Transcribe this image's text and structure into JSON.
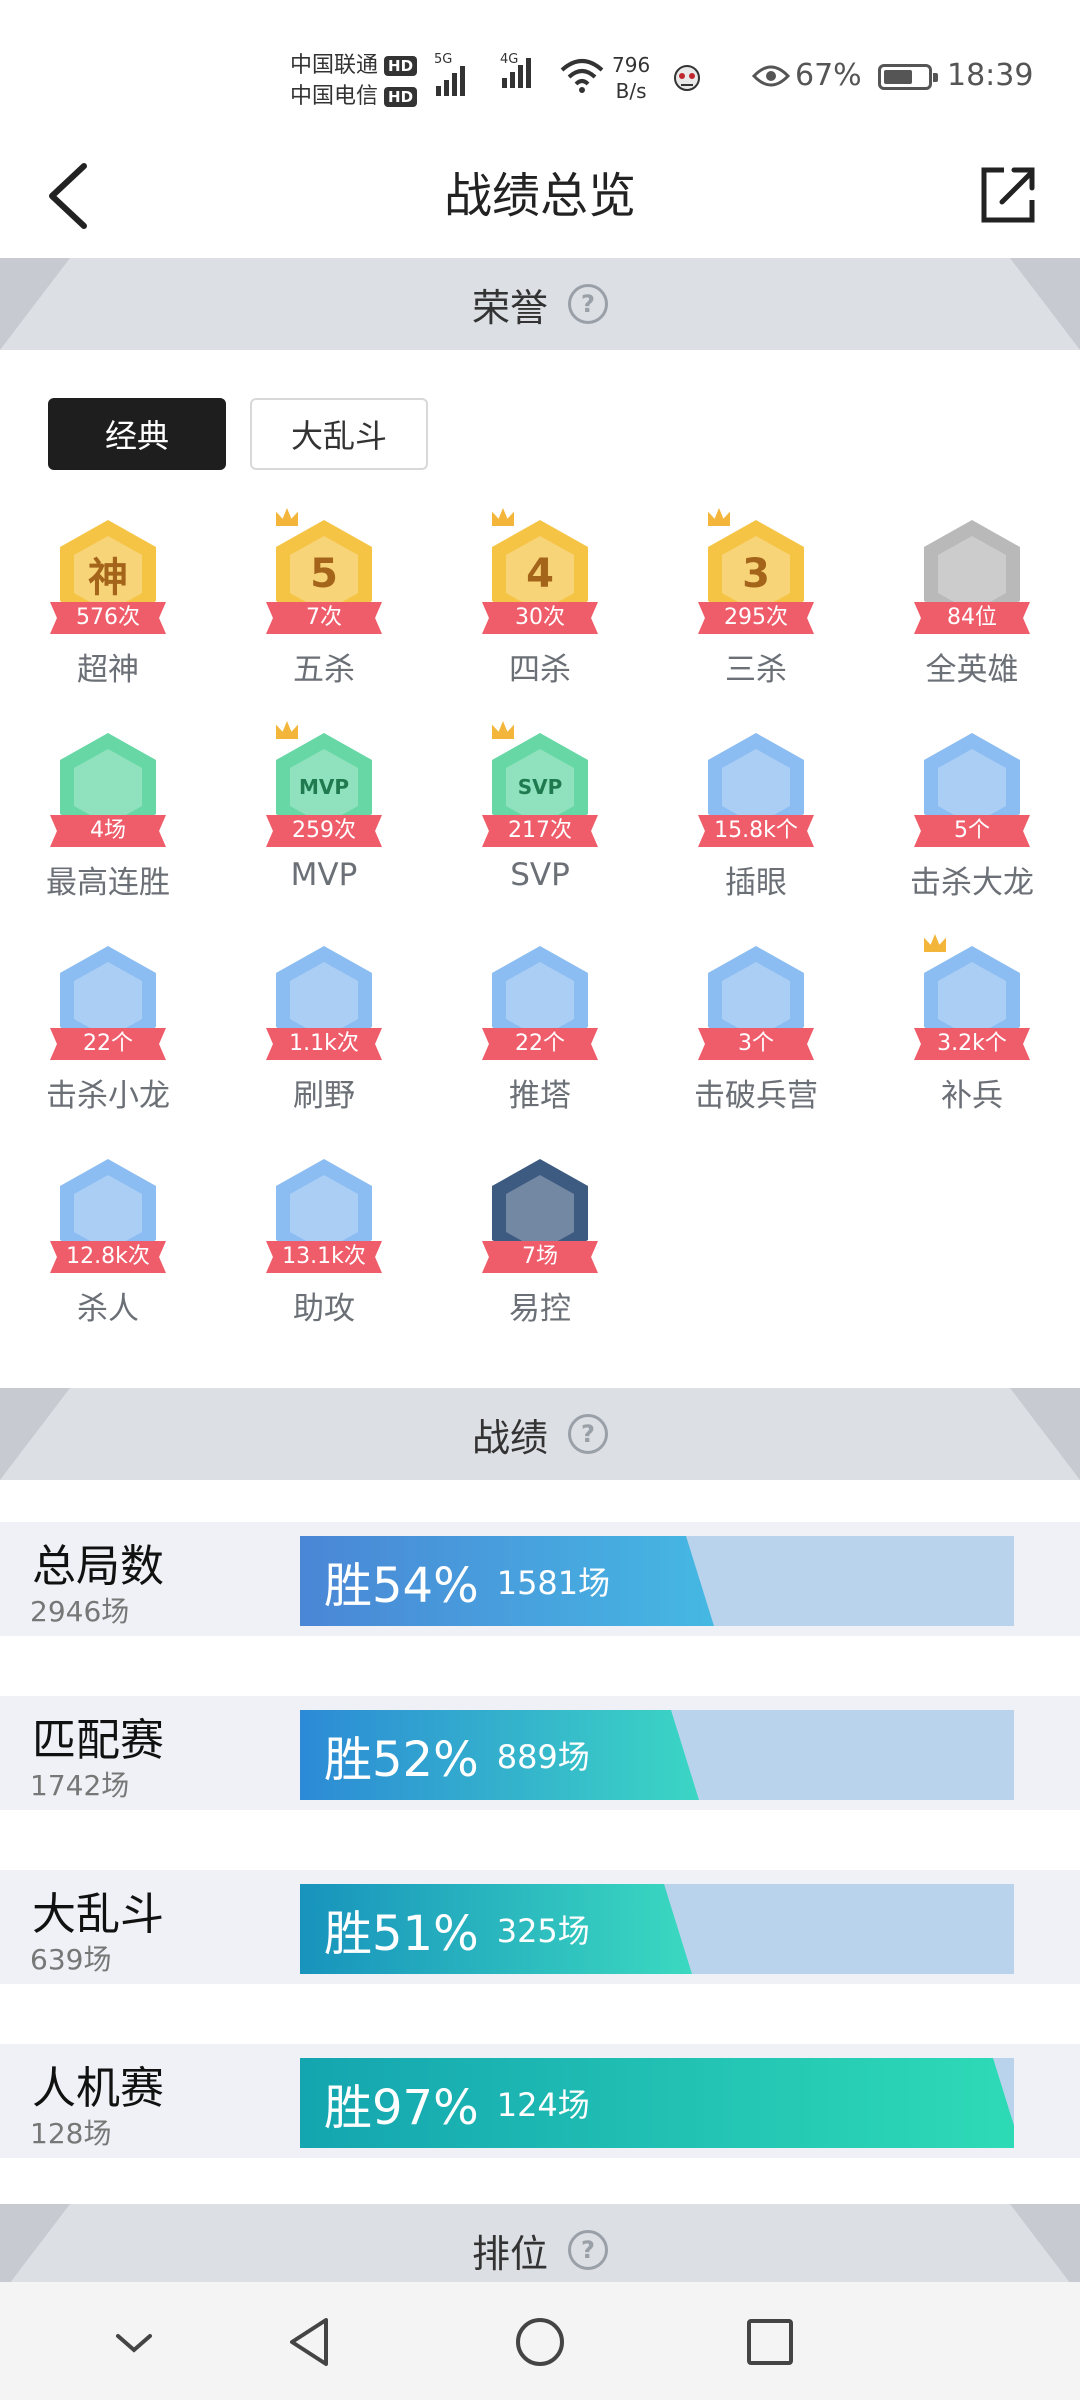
{
  "status_bar": {
    "carrier1": "中国联通",
    "carrier2": "中国电信",
    "hd": "HD",
    "net1": "5G",
    "net2": "4G",
    "speed_value": "796",
    "speed_unit": "B/s",
    "battery_pct": "67%",
    "battery_level": 0.67,
    "time": "18:39"
  },
  "header": {
    "title": "战绩总览",
    "back_icon": "back-chevron-icon",
    "share_icon": "share-external-icon"
  },
  "honor_section": {
    "title": "荣誉",
    "help": "?",
    "tabs": [
      {
        "label": "经典"
      },
      {
        "label": "大乱斗"
      }
    ],
    "items": [
      {
        "glyph": "神",
        "badge": "576次",
        "label": "超神",
        "color": "#f6c445"
      },
      {
        "glyph": "5",
        "badge": "7次",
        "label": "五杀",
        "color": "#f6c445"
      },
      {
        "glyph": "4",
        "badge": "30次",
        "label": "四杀",
        "color": "#f6c445"
      },
      {
        "glyph": "3",
        "badge": "295次",
        "label": "三杀",
        "color": "#f6c445"
      },
      {
        "glyph": "",
        "badge": "84位",
        "label": "全英雄",
        "color": "#b9b9b9"
      },
      {
        "glyph": "",
        "badge": "4场",
        "label": "最高连胜",
        "color": "#66d7a5"
      },
      {
        "glyph": "MVP",
        "badge": "259次",
        "label": "MVP",
        "color": "#66d7a5"
      },
      {
        "glyph": "SVP",
        "badge": "217次",
        "label": "SVP",
        "color": "#66d7a5"
      },
      {
        "glyph": "",
        "badge": "15.8k个",
        "label": "插眼",
        "color": "#8bbcf2"
      },
      {
        "glyph": "",
        "badge": "5个",
        "label": "击杀大龙",
        "color": "#8bbcf2"
      },
      {
        "glyph": "",
        "badge": "22个",
        "label": "击杀小龙",
        "color": "#8bbcf2"
      },
      {
        "glyph": "",
        "badge": "1.1k次",
        "label": "刷野",
        "color": "#8bbcf2"
      },
      {
        "glyph": "",
        "badge": "22个",
        "label": "推塔",
        "color": "#8bbcf2"
      },
      {
        "glyph": "",
        "badge": "3个",
        "label": "击破兵营",
        "color": "#8bbcf2"
      },
      {
        "glyph": "",
        "badge": "3.2k个",
        "label": "补兵",
        "color": "#8bbcf2"
      },
      {
        "glyph": "",
        "badge": "12.8k次",
        "label": "杀人",
        "color": "#8bbcf2"
      },
      {
        "glyph": "",
        "badge": "13.1k次",
        "label": "助攻",
        "color": "#8bbcf2"
      },
      {
        "glyph": "",
        "badge": "7场",
        "label": "易控",
        "color": "#3d5a80"
      }
    ]
  },
  "record_section": {
    "title": "战绩",
    "help": "?",
    "rows": [
      {
        "name": "总局数",
        "count": "2946场",
        "win_text": "胜54%",
        "win_games": "1581场",
        "win_rate": 0.54,
        "from": "#4a86d6",
        "to": "#45b8e3"
      },
      {
        "name": "匹配赛",
        "count": "1742场",
        "win_text": "胜52%",
        "win_games": "889场",
        "win_rate": 0.52,
        "from": "#2c8ad6",
        "to": "#3bd6c4"
      },
      {
        "name": "大乱斗",
        "count": "639场",
        "win_text": "胜51%",
        "win_games": "325场",
        "win_rate": 0.51,
        "from": "#1893bd",
        "to": "#3bd9c0"
      },
      {
        "name": "人机赛",
        "count": "128场",
        "win_text": "胜97%",
        "win_games": "124场",
        "win_rate": 0.97,
        "from": "#14a5b0",
        "to": "#2edbb6"
      }
    ]
  },
  "rank_section": {
    "title": "排位",
    "help": "?"
  },
  "nav_bar": {
    "items": [
      "collapse-icon",
      "back-triangle-icon",
      "home-circle-icon",
      "recents-square-icon"
    ]
  }
}
